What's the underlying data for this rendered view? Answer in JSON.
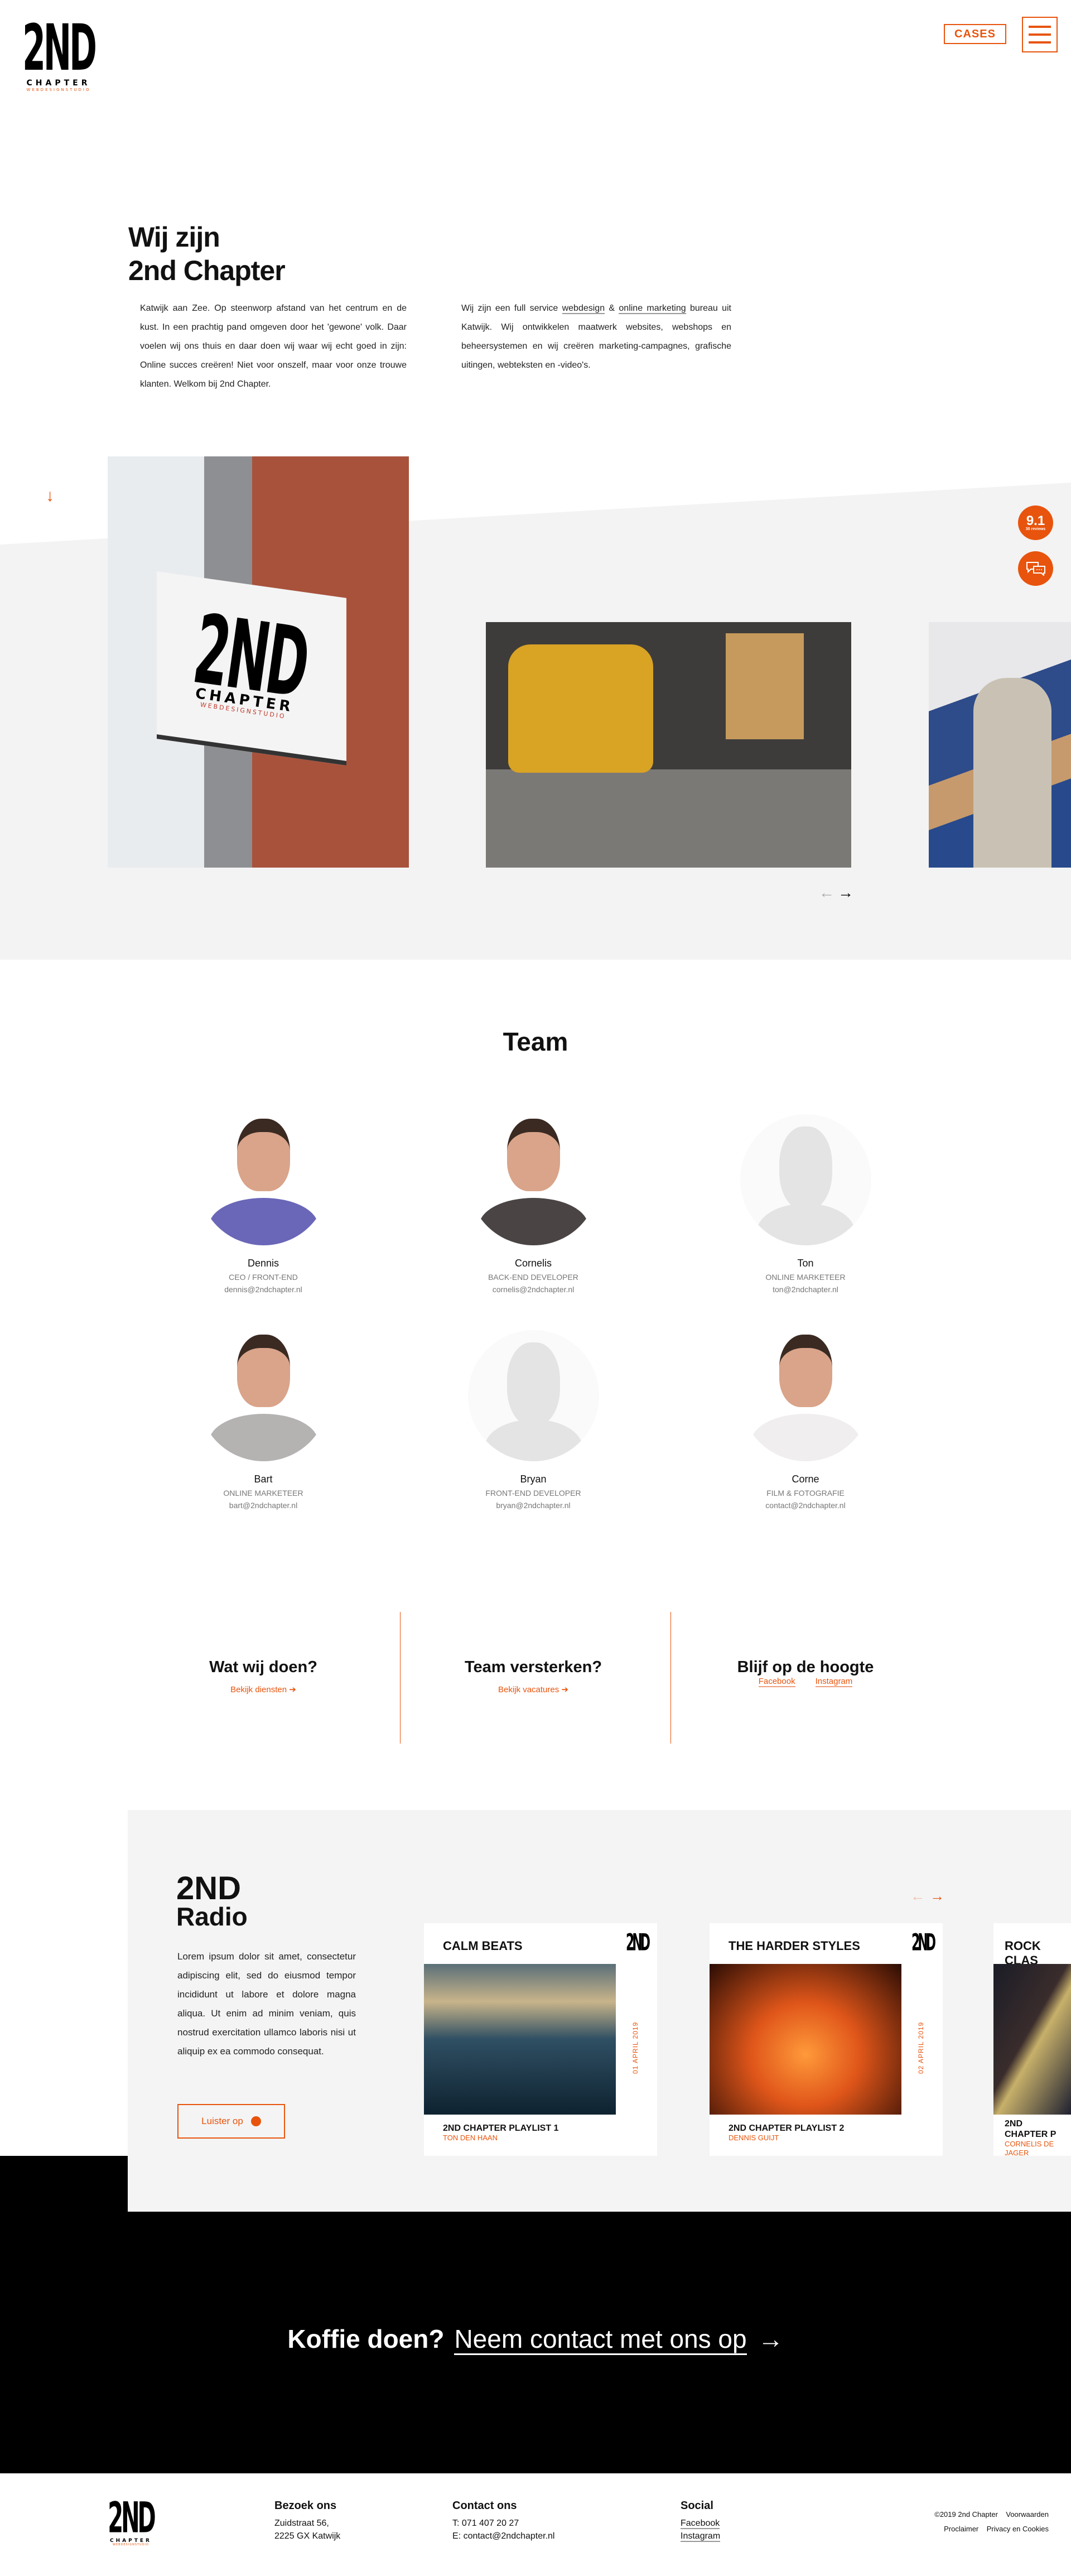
{
  "header": {
    "logo": {
      "big": "2ND",
      "sub": "CHAPTER",
      "tag": "WEBDESIGNSTUDIO"
    },
    "cases_label": "CASES",
    "menu_icon": "hamburger-icon"
  },
  "intro": {
    "title_line1": "Wij zijn",
    "title_line2": "2nd Chapter",
    "left_paragraph": "Katwijk aan Zee. Op steenworp afstand van het centrum en de kust. In een prachtig pand omgeven door het 'gewone' volk. Daar voelen wij ons thuis en daar doen wij waar wij echt goed in zijn: Online succes creëren! Niet voor onszelf, maar voor onze trouwe klanten. Welkom bij 2nd Chapter.",
    "right_p1": "Wij zijn een full service ",
    "right_link1": "webdesign",
    "right_p2": " & ",
    "right_link2": "online marketing",
    "right_p3": " bureau uit Katwijk. Wij ontwikkelen maatwerk websites, webshops en beheersystemen en wij creëren marketing-campagnes, grafische uitingen, webteksten en -video's."
  },
  "gallery": {
    "scroll_icon": "arrow-down-icon",
    "prev_icon": "arrow-left-icon",
    "next_icon": "arrow-right-icon"
  },
  "reviews": {
    "score": "9.1",
    "count": "30 reviews",
    "chat_icon": "chat-icon"
  },
  "team": {
    "title": "Team",
    "members": [
      {
        "name": "Dennis",
        "role": "CEO / Front-end",
        "email": "dennis@2ndchapter.nl"
      },
      {
        "name": "Cornelis",
        "role": "Back-end developer",
        "email": "cornelis@2ndchapter.nl"
      },
      {
        "name": "Ton",
        "role": "Online marketeer",
        "email": "ton@2ndchapter.nl"
      },
      {
        "name": "Bart",
        "role": "Online marketeer",
        "email": "bart@2ndchapter.nl"
      },
      {
        "name": "Bryan",
        "role": "Front-end developer",
        "email": "bryan@2ndchapter.nl"
      },
      {
        "name": "Corne",
        "role": "Film & fotografie",
        "email": "contact@2ndchapter.nl"
      }
    ]
  },
  "cta": [
    {
      "title": "Wat wij doen?",
      "link": "Bekijk diensten"
    },
    {
      "title": "Team versterken?",
      "link": "Bekijk vacatures"
    },
    {
      "title": "Blijf op de hoogte",
      "links": [
        "Facebook",
        "Instagram"
      ]
    }
  ],
  "radio": {
    "title1": "2ND",
    "title2": "Radio",
    "text": "Lorem ipsum dolor sit amet, consectetur adipiscing elit, sed do eiusmod tempor incididunt ut labore et dolore magna aliqua. Ut enim ad minim veniam, quis nostrud exercitation ullamco laboris nisi ut aliquip ex ea commodo consequat.",
    "button": "Luister op",
    "button_icon": "spotify-icon",
    "cards": [
      {
        "title": "CALM BEATS",
        "date": "01 APRIL 2019",
        "playlist": "2ND CHAPTER PLAYLIST 1",
        "author": "TON DEN HAAN"
      },
      {
        "title": "THE HARDER STYLES",
        "date": "02 APRIL 2019",
        "playlist": "2ND CHAPTER PLAYLIST 2",
        "author": "DENNIS GUIJT"
      },
      {
        "title": "ROCK CLAS",
        "date": "",
        "playlist": "2ND CHAPTER P",
        "author": "CORNELIS DE JAGER"
      }
    ]
  },
  "contact_cta": {
    "lead": "Koffie doen?",
    "link": "Neem contact met ons op",
    "arrow": "→"
  },
  "footer": {
    "visit": {
      "title": "Bezoek ons",
      "line1": "Zuidstraat 56,",
      "line2": "2225 GX Katwijk"
    },
    "contact": {
      "title": "Contact ons",
      "phone": "T:  071 407 20 27",
      "email": "E:  contact@2ndchapter.nl"
    },
    "social": {
      "title": "Social",
      "facebook": "Facebook",
      "instagram": "Instagram"
    },
    "legal": {
      "copyright": "©2019 2nd Chapter",
      "terms": "Voorwaarden",
      "proclaimer": "Proclaimer",
      "privacy": "Privacy en Cookies"
    }
  },
  "colors": {
    "accent": "#e8540d",
    "light_gray": "#f3f3f3",
    "black": "#000000"
  }
}
